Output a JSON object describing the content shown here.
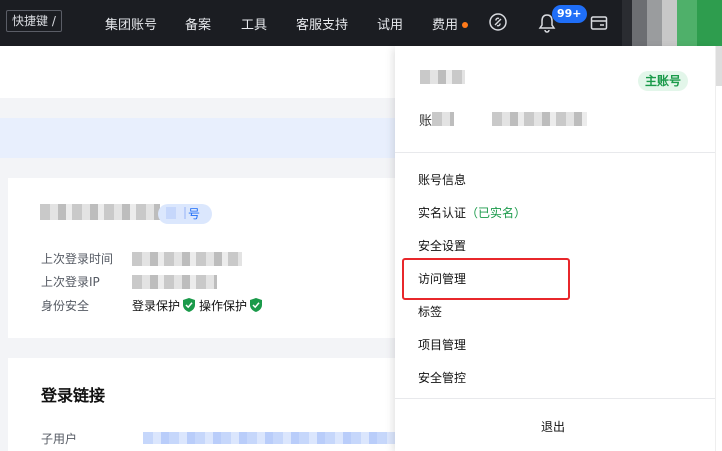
{
  "topbar": {
    "shortcut_label": "快捷键 /",
    "nav": [
      "集团账号",
      "备案",
      "工具",
      "客服支持",
      "试用",
      "费用"
    ],
    "notification_count": "99+"
  },
  "profile_card": {
    "tag_suffix": "号",
    "last_login_time_label": "上次登录时间",
    "last_login_ip_label": "上次登录IP",
    "identity_security_label": "身份安全",
    "login_protection": "登录保护",
    "operation_protection": "操作保护"
  },
  "login_links": {
    "title": "登录链接",
    "sub_user_label": "子用户"
  },
  "dropdown": {
    "main_account_badge": "主账号",
    "account_prefix": "账",
    "items": [
      {
        "label": "账号信息"
      },
      {
        "label": "实名认证",
        "suffix": "（已实名）"
      },
      {
        "label": "安全设置"
      },
      {
        "label": "访问管理"
      },
      {
        "label": "标签"
      },
      {
        "label": "项目管理"
      },
      {
        "label": "安全管控"
      }
    ],
    "logout": "退出"
  },
  "colors": {
    "topbar_bg": "#1b1d22",
    "accent_blue": "#1f6ef7",
    "verified_green": "#1a9a4a",
    "highlight_red": "#e8272b"
  }
}
